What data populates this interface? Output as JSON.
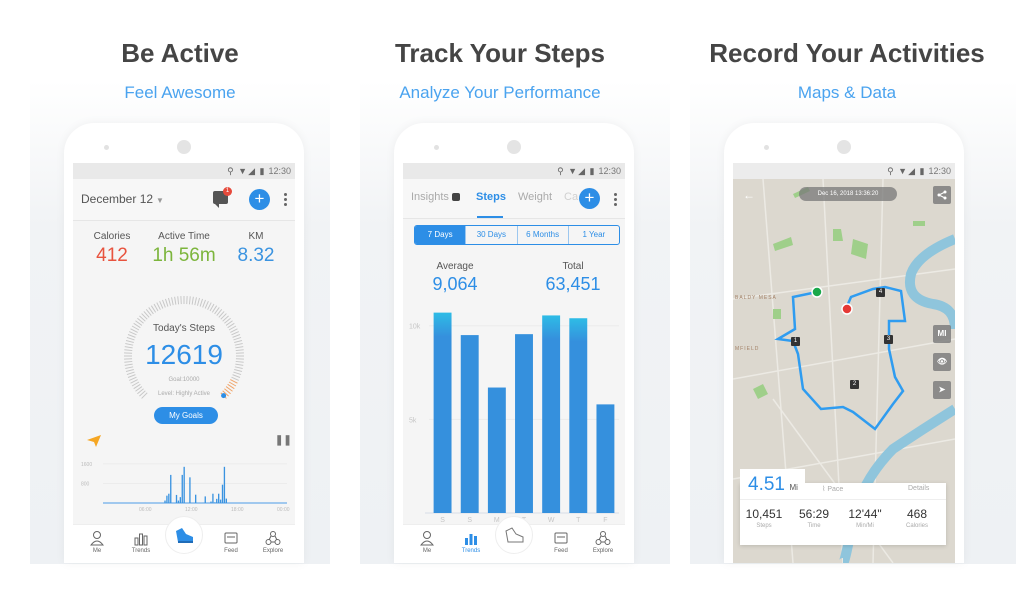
{
  "panels": [
    {
      "headline": "Be Active",
      "subline": "Feel Awesome"
    },
    {
      "headline": "Track Your Steps",
      "subline": "Analyze Your Performance"
    },
    {
      "headline": "Record Your Activities",
      "subline": "Maps & Data"
    }
  ],
  "status_bar": {
    "time": "12:30"
  },
  "colors": {
    "accent": "#2d8ee6",
    "calories": "#e8533e",
    "active_time": "#7cb53c",
    "km": "#3a93e0",
    "subline": "#4aa3ef"
  },
  "screen1": {
    "date_selector": "December 12",
    "notification_count": "1",
    "stats": [
      {
        "label": "Calories",
        "value": "412"
      },
      {
        "label": "Active Time",
        "value": "1h 56m"
      },
      {
        "label": "KM",
        "value": "8.32"
      }
    ],
    "today_steps_label": "Today's Steps",
    "today_steps_value": "12619",
    "goal_text": "Goal:10000",
    "level_text": "Level: Highly Active",
    "goal_progress": 1.26,
    "my_goals_button": "My Goals",
    "hourly_chart": {
      "y_ticks": [
        "1600",
        "800"
      ],
      "x_ticks": [
        "06:00",
        "12:00",
        "18:00",
        "00:00"
      ],
      "values": [
        0,
        0,
        0,
        0,
        0,
        0,
        0,
        0,
        0,
        0,
        0,
        0,
        0,
        0,
        0,
        0,
        0,
        0,
        0,
        0,
        0,
        0,
        0,
        0,
        0,
        0,
        0,
        0,
        0,
        0,
        0,
        0,
        100,
        300,
        380,
        1150,
        0,
        0,
        330,
        100,
        240,
        1150,
        1480,
        0,
        0,
        1050,
        0,
        0,
        340,
        0,
        0,
        0,
        10,
        270,
        0,
        0,
        60,
        380,
        30,
        170,
        380,
        140,
        750,
        1480,
        180,
        0,
        0,
        0,
        0,
        0,
        0,
        0,
        0,
        0,
        0,
        0,
        0,
        0,
        0,
        0,
        0,
        0,
        0,
        0,
        0,
        0,
        0,
        0,
        0,
        0,
        0,
        0,
        0,
        0,
        0,
        0
      ]
    }
  },
  "screen2": {
    "tabs": [
      "Insights",
      "Steps",
      "Weight",
      "Ca"
    ],
    "active_tab": "Steps",
    "ranges": [
      "7 Days",
      "30 Days",
      "6 Months",
      "1 Year"
    ],
    "active_range": "7 Days",
    "average_label": "Average",
    "average_value": "9,064",
    "total_label": "Total",
    "total_value": "63,451"
  },
  "chart_data": {
    "type": "bar",
    "title": "",
    "xlabel": "",
    "ylabel": "",
    "categories": [
      "S",
      "S",
      "M",
      "T",
      "W",
      "T",
      "F"
    ],
    "values": [
      10700,
      9500,
      6700,
      9550,
      10550,
      10400,
      5800
    ],
    "y_ticks": [
      "10k",
      "5k"
    ],
    "ylim": [
      0,
      11000
    ],
    "grid": true
  },
  "screen3": {
    "timestamp_pill": "Dec 16, 2018 13:36:20",
    "map_labels": [
      "BALDY MESA",
      "MFIELD"
    ],
    "route_markers": [
      "1",
      "2",
      "3",
      "4"
    ],
    "map_buttons": [
      "MI"
    ],
    "distance_value": "4.51",
    "distance_unit": "Mi",
    "pace_tab": "Pace",
    "details_tab": "Details",
    "summary": [
      {
        "value": "10,451",
        "label": "Steps"
      },
      {
        "value": "56:29",
        "label": "Time"
      },
      {
        "value": "12'44\"",
        "label": "Min/Mi"
      },
      {
        "value": "468",
        "label": "Calories"
      }
    ]
  },
  "bottom_nav": [
    "Me",
    "Trends",
    "Feed",
    "Explore"
  ]
}
